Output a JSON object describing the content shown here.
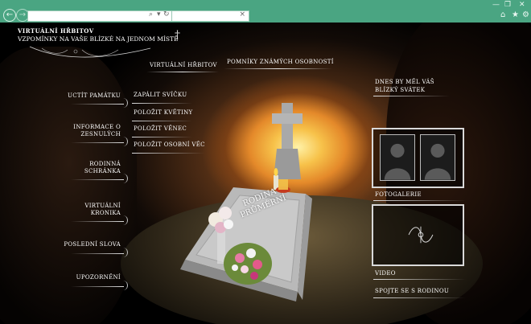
{
  "browser": {
    "back_icon": "back-arrow-icon",
    "forward_icon": "forward-arrow-icon",
    "controls": [
      "minimize-icon",
      "restore-icon",
      "close-icon"
    ],
    "toolbar_icons": [
      "home-icon",
      "star-icon",
      "gear-icon"
    ]
  },
  "logo": {
    "line1": "VIRTUÁLNÍ HŘBITOV",
    "line2": "VZPOMÍNKY NA VAŠE BLÍZKÉ NA JEDNOM MÍSTĚ"
  },
  "topnav": {
    "item1": "VIRTUÁLNÍ HŘBITOV",
    "item2": "POMNÍKY ZNÁMÝCH OSOBNOSTÍ"
  },
  "leftmenu": {
    "items": [
      {
        "label": "UCTÍT PAMÁTKU"
      },
      {
        "label": "INFORMACE O ZESNULÝCH"
      },
      {
        "label": "RODINNÁ SCHRÁNKA"
      },
      {
        "label": "VIRTUÁLNÍ KRONIKA"
      },
      {
        "label": "POSLEDNÍ SLOVA"
      },
      {
        "label": "UPOZORNĚNÍ"
      }
    ]
  },
  "actions": {
    "items": [
      {
        "label": "ZAPÁLIT SVÍČKU"
      },
      {
        "label": "POLOŽIT KVĚTINY"
      },
      {
        "label": "POLOŽIT VĚNEC"
      },
      {
        "label": "POLOŽIT OSOBNÍ VĚC"
      }
    ]
  },
  "grave": {
    "inscription_line1": "RODINA",
    "inscription_line2": "PRŮMĚRNÍ"
  },
  "right": {
    "birthday": "DNES BY MĚL VÁŠ BLÍZKÝ SVÁTEK",
    "gallery": "FOTOGALERIE",
    "video": "VIDEO",
    "contact": "SPOJTE SE S RODINOU"
  }
}
